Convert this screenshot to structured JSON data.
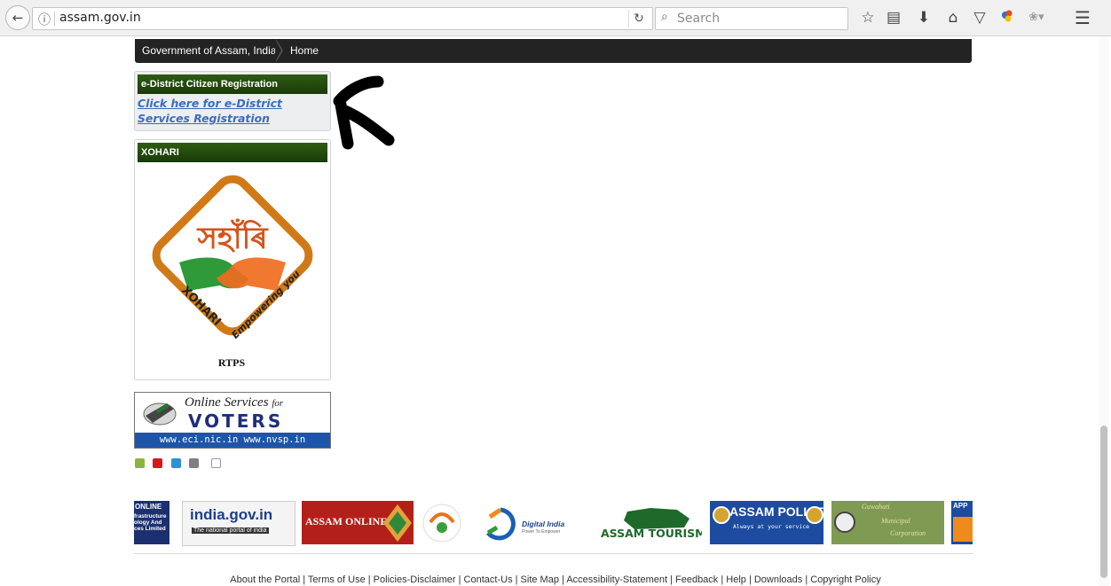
{
  "browser": {
    "url": "assam.gov.in",
    "search_placeholder": "Search",
    "icons": [
      "back-icon",
      "site-info-icon",
      "reload-icon",
      "search-icon",
      "bookmark-star-icon",
      "reading-list-icon",
      "download-icon",
      "home-icon",
      "pocket-icon",
      "extension-icon",
      "extension-icon",
      "menu-icon"
    ]
  },
  "breadcrumb": {
    "items": [
      "Government of Assam, India",
      "Home"
    ]
  },
  "registration": {
    "heading": "e-District Citizen Registration",
    "link_line1": "Click here for e-District",
    "link_line2": "Services Registration"
  },
  "xohari": {
    "heading": "XOHARI",
    "logo_script": "সহাঁৰি",
    "logo_left": "XOHARI",
    "logo_right": "Empowering you",
    "caption": "RTPS"
  },
  "voters": {
    "line1": "Online Services",
    "line1_small": "for",
    "line2": "VOTERS",
    "sites": "www.eci.nic.in  www.nvsp.in"
  },
  "theme_colors": [
    "#8db43e",
    "#d8161d",
    "#2f90d6",
    "#7f7f7f",
    "#ffffff"
  ],
  "partner_logos": {
    "online": {
      "title": "ONLINE",
      "lines": [
        "frastructure",
        "ology And",
        "ces Limited"
      ]
    },
    "india": {
      "title": "india.gov.in",
      "sub": "The national portal of india"
    },
    "assam_online": "ASSAM ONLINE",
    "digital_india": {
      "title": "Digital India",
      "sub": "Power To Empower"
    },
    "tourism": "ASSAM TOURISM",
    "police": {
      "title": "ASSAM POLICE",
      "sub": "Always at your service"
    },
    "guwahati": [
      "Guwahati",
      "Municipal",
      "Corporation"
    ],
    "app": "APP"
  },
  "footer": {
    "text": "About the Portal  | Terms of Use  | Policies-Disclaimer |  Contact-Us | Site Map | Accessibility-Statement | Feedback | Help | Downloads | Copyright Policy"
  }
}
